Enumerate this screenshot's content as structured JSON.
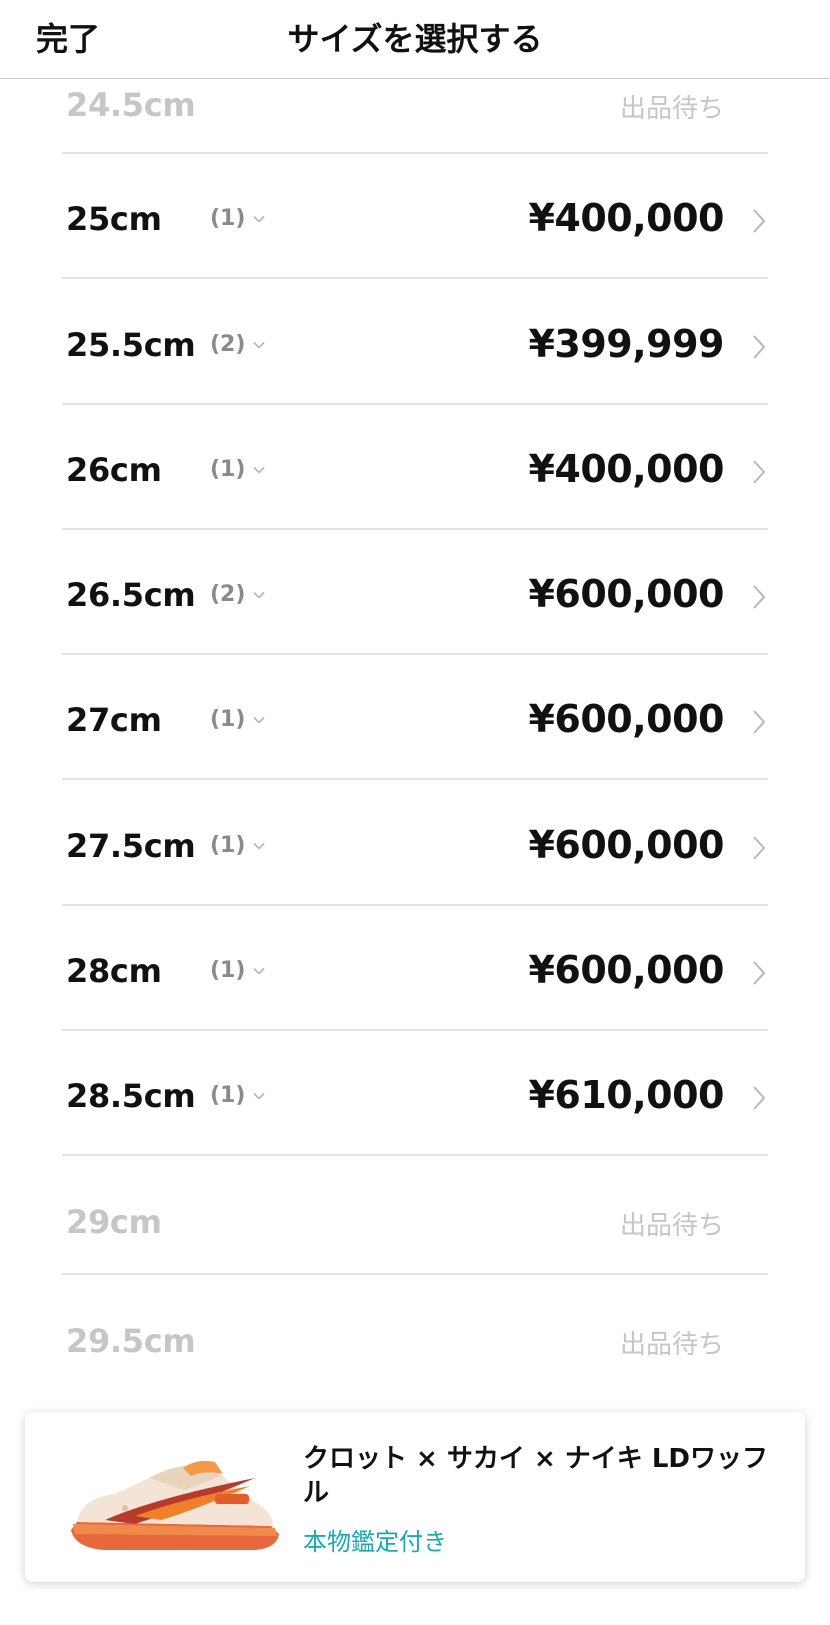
{
  "header": {
    "done_label": "完了",
    "title": "サイズを選択する"
  },
  "sizes": [
    {
      "size": "24.5cm",
      "count": "",
      "price": "",
      "status": "出品待ち",
      "available": false
    },
    {
      "size": "25cm",
      "count": "(1)",
      "price": "¥400,000",
      "status": "",
      "available": true
    },
    {
      "size": "25.5cm",
      "count": "(2)",
      "price": "¥399,999",
      "status": "",
      "available": true
    },
    {
      "size": "26cm",
      "count": "(1)",
      "price": "¥400,000",
      "status": "",
      "available": true
    },
    {
      "size": "26.5cm",
      "count": "(2)",
      "price": "¥600,000",
      "status": "",
      "available": true
    },
    {
      "size": "27cm",
      "count": "(1)",
      "price": "¥600,000",
      "status": "",
      "available": true
    },
    {
      "size": "27.5cm",
      "count": "(1)",
      "price": "¥600,000",
      "status": "",
      "available": true
    },
    {
      "size": "28cm",
      "count": "(1)",
      "price": "¥600,000",
      "status": "",
      "available": true
    },
    {
      "size": "28.5cm",
      "count": "(1)",
      "price": "¥610,000",
      "status": "",
      "available": true
    },
    {
      "size": "29cm",
      "count": "",
      "price": "",
      "status": "出品待ち",
      "available": false
    },
    {
      "size": "29.5cm",
      "count": "",
      "price": "",
      "status": "出品待ち",
      "available": false
    }
  ],
  "product": {
    "name": "クロット × サカイ × ナイキ LDワッフル",
    "badge": "本物鑑定付き",
    "image_icon": "sneaker-image"
  },
  "colors": {
    "accent": "#1ba8b0",
    "muted_text": "#c6c6c6",
    "divider": "#e4e4e4"
  }
}
